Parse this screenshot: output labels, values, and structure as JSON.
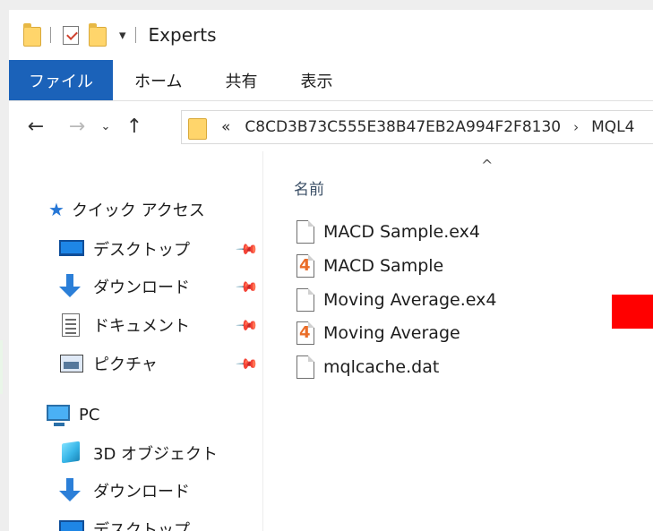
{
  "titlebar": {
    "title": "Experts",
    "dropdown_glyph": "▾",
    "icons": [
      "folder-icon",
      "properties-icon",
      "new-folder-icon",
      "customize-dropdown-icon"
    ]
  },
  "ribbon": {
    "tabs": [
      "ファイル",
      "ホーム",
      "共有",
      "表示"
    ]
  },
  "navigation": {
    "back": "←",
    "forward": "→",
    "recent": "⌄",
    "up": "↑",
    "overflow": "«",
    "path_segments": [
      "C8CD3B73C555E38B47EB2A994F2F8130",
      "MQL4"
    ],
    "separator": "›"
  },
  "sidebar": {
    "quick_access": "クイック アクセス",
    "pinned": [
      {
        "label": "デスクトップ",
        "icon": "desktop-icon"
      },
      {
        "label": "ダウンロード",
        "icon": "download-icon"
      },
      {
        "label": "ドキュメント",
        "icon": "documents-icon"
      },
      {
        "label": "ピクチャ",
        "icon": "pictures-icon"
      }
    ],
    "pc": "PC",
    "pc_items": [
      {
        "label": "3D オブジェクト",
        "icon": "3d-objects-icon"
      },
      {
        "label": "ダウンロード",
        "icon": "download-icon"
      },
      {
        "label": "デスクトップ",
        "icon": "desktop-icon"
      }
    ],
    "pin_glyph": "📌"
  },
  "content": {
    "sort_caret": "^",
    "column_header": "名前",
    "files": [
      {
        "name": "MACD Sample.ex4",
        "type": "file"
      },
      {
        "name": "MACD Sample",
        "type": "mql4",
        "badge": "4"
      },
      {
        "name": "Moving Average.ex4",
        "type": "file"
      },
      {
        "name": "Moving Average",
        "type": "mql4",
        "badge": "4"
      },
      {
        "name": "mqlcache.dat",
        "type": "file"
      }
    ]
  },
  "colors": {
    "file_tab": "#1b62b9",
    "folder": "#ffd56b",
    "mql4_badge": "#ea6d28",
    "red_block": "#ff0000"
  }
}
